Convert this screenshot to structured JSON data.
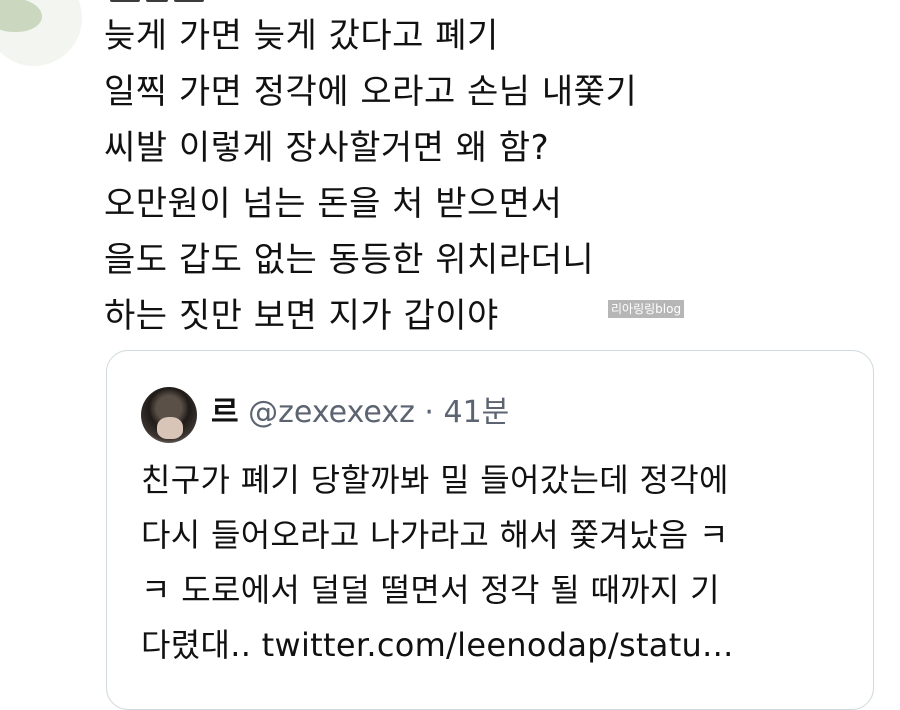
{
  "tweet": {
    "lines": [
      "늦게 가면 늦게 갔다고 폐기",
      "일찍 가면 정각에 오라고 손님 내쫓기",
      "씨발 이렇게 장사할거면 왜 함?",
      "오만원이 넘는 돈을 처 받으면서",
      "을도 갑도 없는 동등한 위치라더니",
      "하는 짓만 보면 지가 갑이야"
    ]
  },
  "watermark": "리아링링blog",
  "quote": {
    "name": "르",
    "handle": "@zexexexz",
    "separator": "·",
    "time": "41분",
    "lines": [
      "친구가 폐기 당할까봐 밀 들어갔는데 정각에",
      "다시 들어오라고 나가라고 해서 쫓겨났음 ㅋ",
      "ㅋ 도로에서 덜덜 떨면서 정각 될 때까지 기",
      "다렸대.. twitter.com/leenodap/statu..."
    ]
  },
  "colors": {
    "text": "#111111",
    "muted": "#5b6470",
    "card_border": "#cfd9de",
    "watermark_bg": "#b6b6b6"
  }
}
